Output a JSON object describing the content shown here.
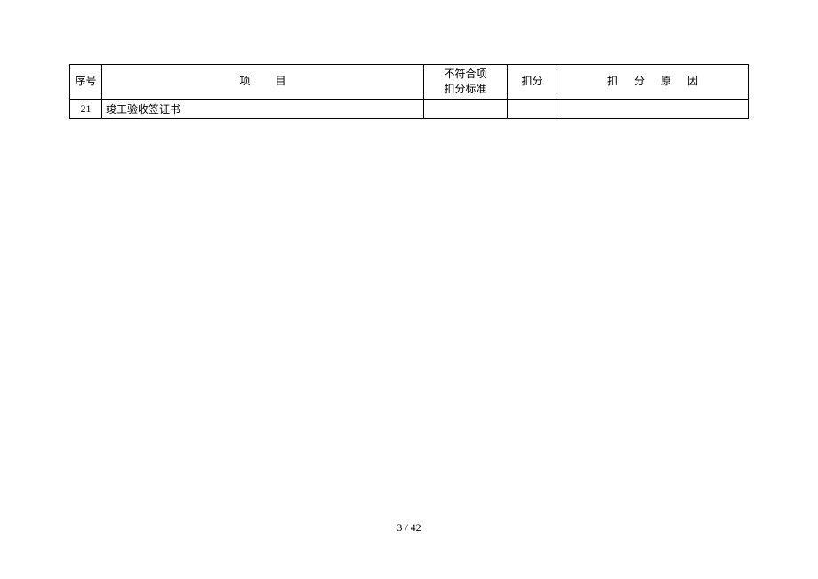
{
  "table": {
    "headers": {
      "seq": "序号",
      "item": "项目",
      "nonconform_line1": "不符合项",
      "nonconform_line2": "扣分标准",
      "deduct": "扣分",
      "reason": "扣分原因"
    },
    "rows": [
      {
        "seq": "21",
        "item": "竣工验收签证书",
        "nonconform": "",
        "deduct": "",
        "reason": ""
      }
    ]
  },
  "pagination": {
    "current": "3",
    "separator": " / ",
    "total": "42"
  }
}
